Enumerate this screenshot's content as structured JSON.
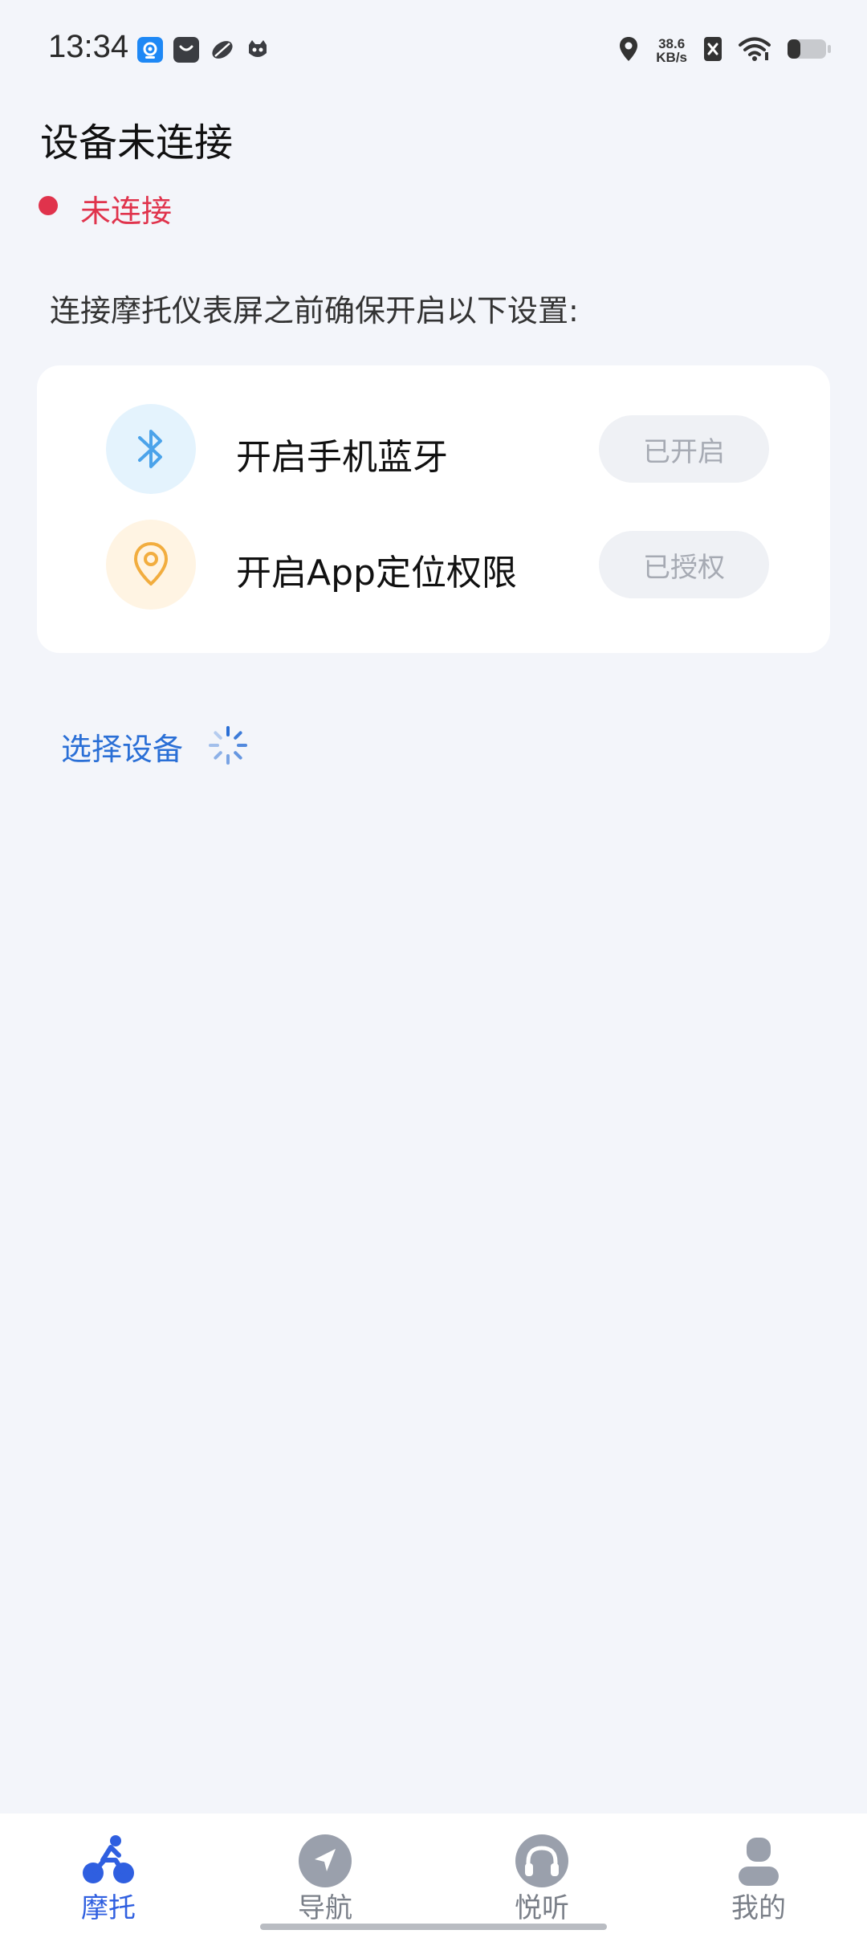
{
  "status_bar": {
    "time": "13:34",
    "net_speed_value": "38.6",
    "net_speed_unit": "KB/s",
    "icons": [
      "app-icon-blue",
      "app-icon-bag",
      "app-icon-leaf",
      "app-icon-cat",
      "location-icon",
      "net-speed",
      "sim-off-icon",
      "wifi-icon",
      "battery-icon"
    ]
  },
  "header": {
    "title": "设备未连接",
    "status": "未连接",
    "status_color": "#e0334c"
  },
  "intro": "连接摩托仪表屏之前确保开启以下设置:",
  "settings": [
    {
      "label": "开启手机蓝牙",
      "state": "已开启",
      "icon": "bluetooth-icon",
      "icon_color": "#4ba3ea"
    },
    {
      "label": "开启App定位权限",
      "state": "已授权",
      "icon": "location-pin-icon",
      "icon_color": "#f2ad3f"
    }
  ],
  "select_device": "选择设备",
  "nav": [
    {
      "label": "摩托",
      "icon": "motorbike-icon",
      "active": true
    },
    {
      "label": "导航",
      "icon": "navigation-icon",
      "active": false
    },
    {
      "label": "悦听",
      "icon": "headphones-icon",
      "active": false
    },
    {
      "label": "我的",
      "icon": "profile-icon",
      "active": false
    }
  ],
  "colors": {
    "accent": "#2f5fe0",
    "link": "#2a6fd6",
    "background": "#f3f5fa"
  }
}
